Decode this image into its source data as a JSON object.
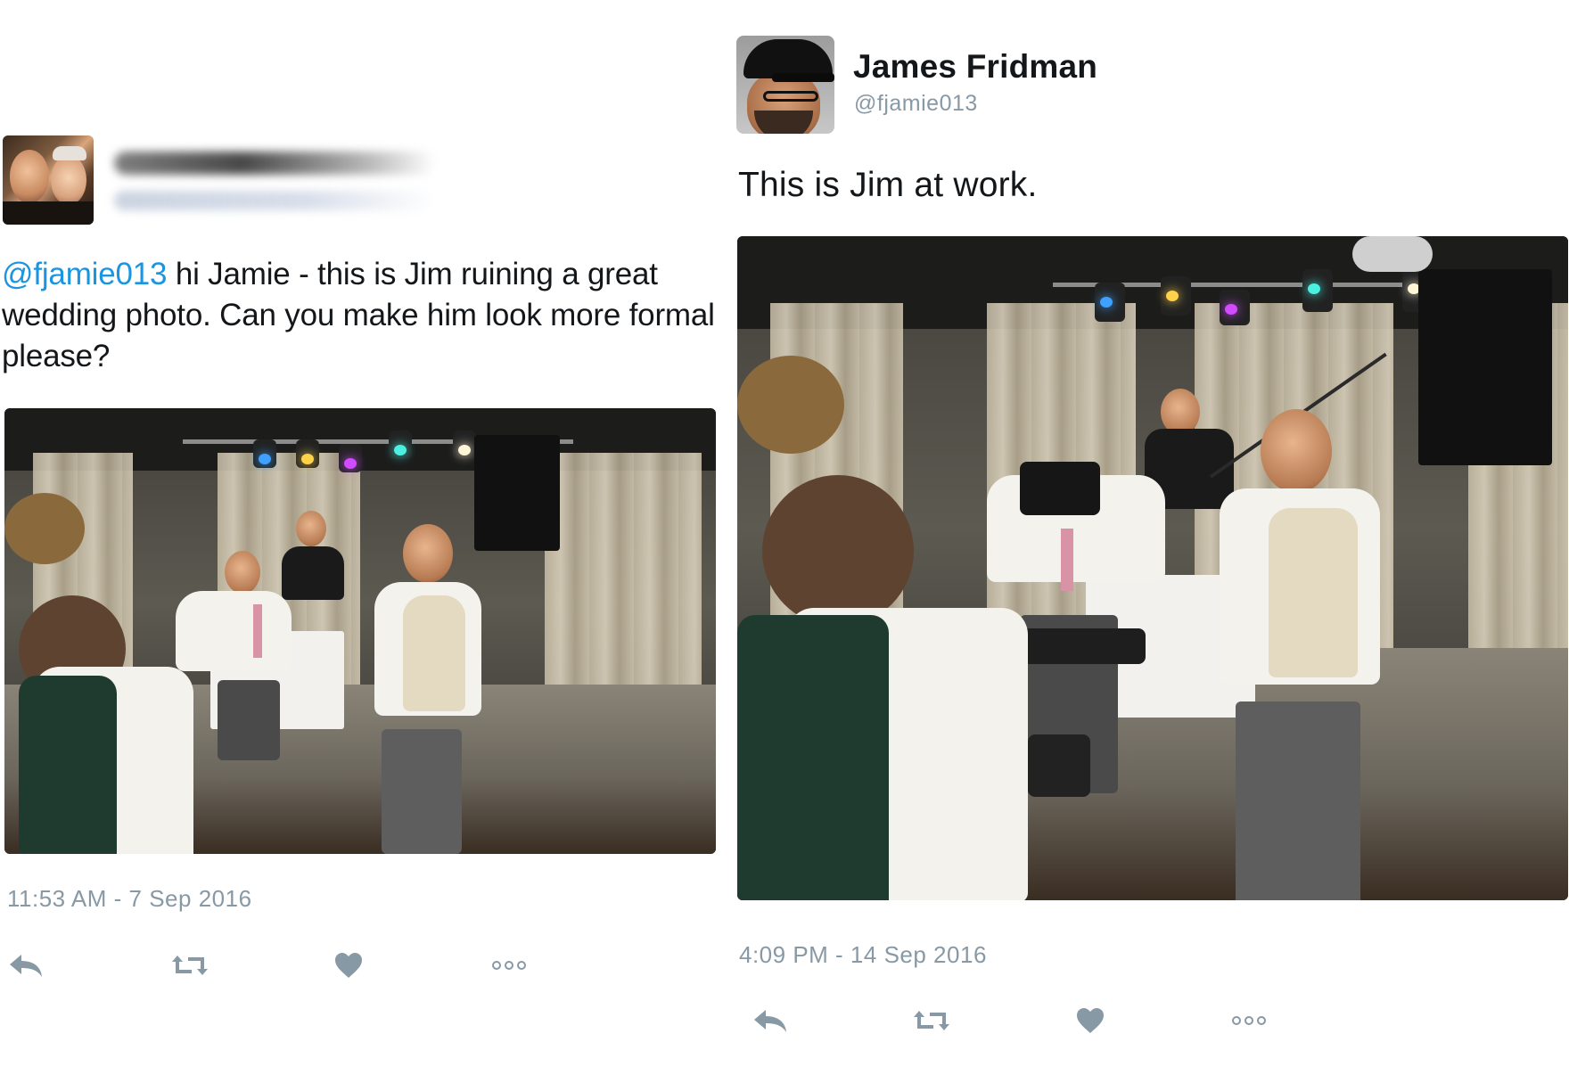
{
  "left_tweet": {
    "author_name_blurred": true,
    "mention": "@fjamie013",
    "text": " hi Jamie - this is Jim ruining a great wedding photo. Can you make him look more formal please?",
    "timestamp": "11:53 AM - 7 Sep 2016",
    "photo_icon": "wedding-photo-image"
  },
  "right_tweet": {
    "author_name": "James Fridman",
    "handle": "@fjamie013",
    "text": "This is Jim at work.",
    "timestamp": "4:09 PM - 14 Sep 2016",
    "photo_icon": "edited-photo-image"
  },
  "actions": {
    "icons": [
      "reply-icon",
      "retweet-icon",
      "like-icon",
      "more-icon"
    ]
  },
  "colors": {
    "mention": "#1b95e0",
    "meta_gray": "#8899a6",
    "text": "#14171a"
  }
}
